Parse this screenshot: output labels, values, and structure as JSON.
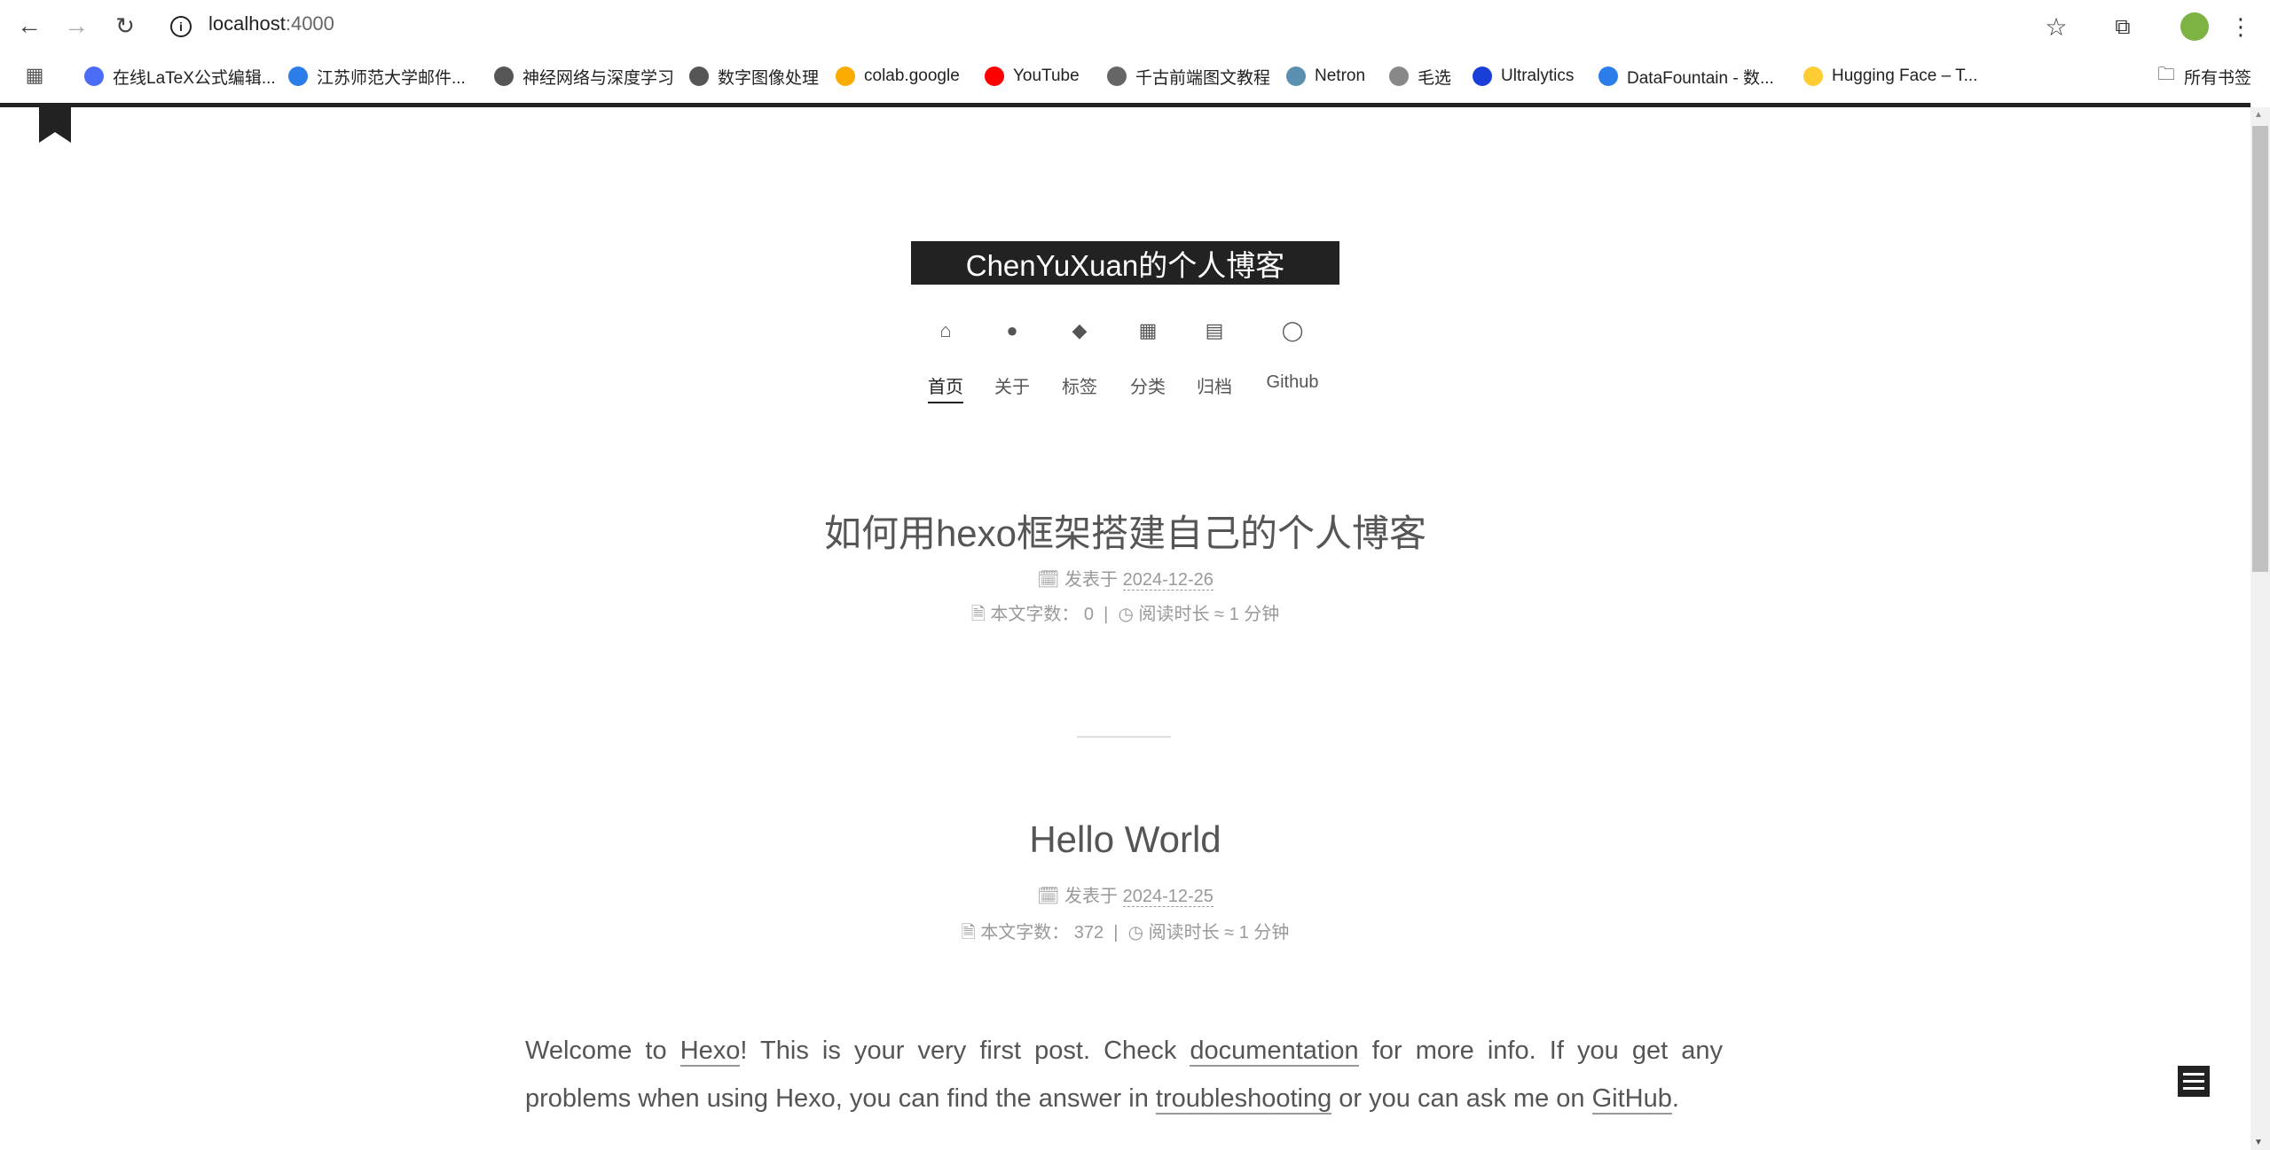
{
  "browser": {
    "url_host": "localhost",
    "url_port": ":4000",
    "all_bookmarks": "所有书签",
    "bookmarks": [
      {
        "label": "在线LaTeX公式编辑...",
        "color": "#4a6cf7"
      },
      {
        "label": "江苏师范大学邮件...",
        "color": "#2b7de9"
      },
      {
        "label": "神经网络与深度学习",
        "color": "#555555"
      },
      {
        "label": "数字图像处理",
        "color": "#555555"
      },
      {
        "label": "colab.google",
        "color": "#f9ab00"
      },
      {
        "label": "YouTube",
        "color": "#ff0000"
      },
      {
        "label": "千古前端图文教程",
        "color": "#666666"
      },
      {
        "label": "Netron",
        "color": "#5a8fb0"
      },
      {
        "label": "毛选",
        "color": "#888888"
      },
      {
        "label": "Ultralytics",
        "color": "#1a3fd8"
      },
      {
        "label": "DataFountain - 数...",
        "color": "#2b7de9"
      },
      {
        "label": "Hugging Face – T...",
        "color": "#ffcc33"
      }
    ]
  },
  "site": {
    "title": "ChenYuXuan的个人博客",
    "nav": [
      {
        "label": "首页",
        "icon": "home-icon"
      },
      {
        "label": "关于",
        "icon": "user-icon"
      },
      {
        "label": "标签",
        "icon": "tags-icon"
      },
      {
        "label": "分类",
        "icon": "grid-icon"
      },
      {
        "label": "归档",
        "icon": "archive-icon"
      },
      {
        "label": "Github",
        "icon": "github-icon"
      }
    ]
  },
  "posts": [
    {
      "title": "如何用hexo框架搭建自己的个人博客",
      "posted_label": "发表于",
      "date": "2024-12-26",
      "words_label": "本文字数：",
      "words": "0",
      "read_label": "阅读时长 ≈",
      "read_time": "1 分钟"
    },
    {
      "title": "Hello World",
      "posted_label": "发表于",
      "date": "2024-12-25",
      "words_label": "本文字数：",
      "words": "372",
      "read_label": "阅读时长 ≈",
      "read_time": "1 分钟"
    }
  ],
  "excerpt": {
    "t1": "Welcome to ",
    "l1": "Hexo",
    "t2": "! This is your very first post. Check ",
    "l2": "documentation",
    "t3": " for more info. If you get any problems when using Hexo, you can find the answer in ",
    "l3": "troubleshooting",
    "t4": " or you can ask me on ",
    "l4": "GitHub",
    "t5": "."
  },
  "separator": "|"
}
